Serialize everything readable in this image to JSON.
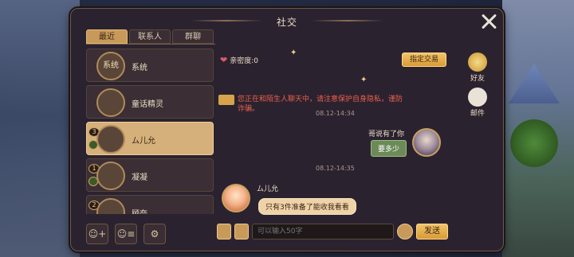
{
  "window": {
    "title": "社交"
  },
  "tabs": [
    {
      "label": "最近",
      "active": true
    },
    {
      "label": "联系人",
      "active": false
    },
    {
      "label": "群聊",
      "active": false
    }
  ],
  "contacts": [
    {
      "avatar_text": "系统",
      "name": "系统",
      "selected": false
    },
    {
      "name": "童话精灵",
      "selected": false
    },
    {
      "level": "3",
      "name": "ム儿允",
      "selected": true
    },
    {
      "level": "1",
      "name": "凝凝",
      "selected": false
    },
    {
      "level": "2",
      "name": "顾奈",
      "selected": false
    }
  ],
  "chat": {
    "intimacy_label": "亲密度:0",
    "trade_button": "指定交易",
    "warning": "您正在和陌生人聊天中，请注意保护自身隐私，谨防诈骗。",
    "time1": "08.12-14:34",
    "right_name": "哥说有了你",
    "right_msg": "要多少",
    "time2": "08.12-14:35",
    "left_name": "ム儿允",
    "left_msg": "只有3件准备了能收我看看"
  },
  "side_tabs": [
    {
      "label": "好友"
    },
    {
      "label": "邮件"
    }
  ],
  "input": {
    "placeholder": "可以输入50字",
    "send_label": "发送"
  },
  "colors": {
    "accent": "#d99a34",
    "selected_row": "#d6b07a",
    "warning": "#e8614a",
    "bubble_right": "#6b8a58"
  }
}
